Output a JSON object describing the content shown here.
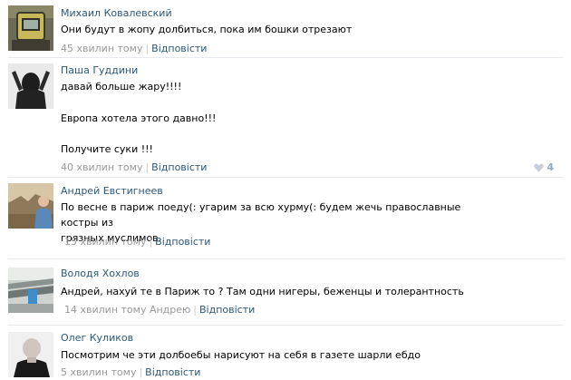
{
  "comments": [
    {
      "author": "Михаил Ковалевский",
      "lines": [
        "Они будут в жопу долбиться, пока им бошки отрезают"
      ],
      "time": "45 хвилин тому",
      "reply": "Відповісти"
    },
    {
      "author": "Паша Гуддини",
      "lines": [
        "давай больше жару!!!!",
        "Европа хотела этого давно!!!",
        "Получите суки !!!"
      ],
      "time": "40 хвилин тому",
      "reply": "Відповісти",
      "likes": "4"
    },
    {
      "author": "Андрей Евстигнеев",
      "lines": [
        "По весне в париж поеду(: угарим за всю хурму(: будем жечь православные костры из",
        "грязных муслимов."
      ],
      "time": "15 хвилин тому",
      "reply": "Відповісти"
    },
    {
      "author": "Володя Хохлов",
      "lines": [
        "Андрей, нахуй те в Париж то ? Там одни нигеры, беженцы и толерантность"
      ],
      "time": "14 хвилин тому",
      "mention": "Андрею",
      "reply": "Відповісти"
    },
    {
      "author": "Олег Куликов",
      "lines": [
        "Посмотрим че эти долбоебы нарисуют на себя в газете шарли ебдо"
      ],
      "time": "5 хвилин тому",
      "reply": "Відповісти"
    }
  ],
  "colors": {
    "link": "#2b587a",
    "meta": "#999999",
    "divider": "#e7ebef",
    "like": "#94a8bd"
  }
}
